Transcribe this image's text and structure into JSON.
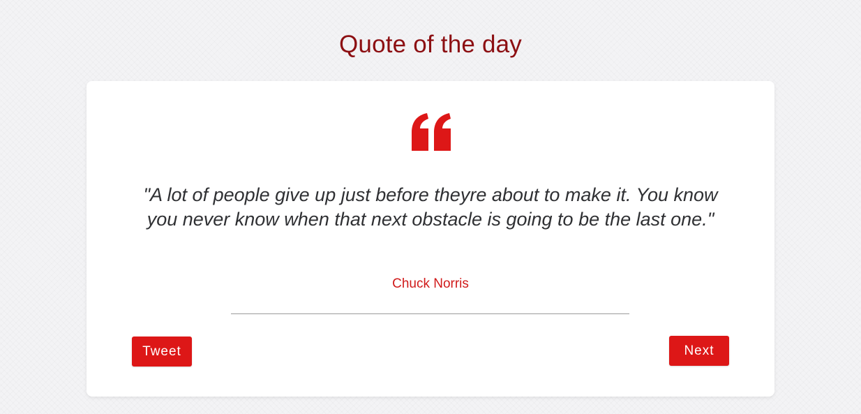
{
  "header": {
    "title": "Quote of the day"
  },
  "card": {
    "quote_icon": "quote-open-icon",
    "quote_text": "\"A lot of people give up just before theyre about to make it. You know you never know when that next obstacle is going to be the last one.\"",
    "author": "Chuck Norris"
  },
  "actions": {
    "tweet_label": "Tweet",
    "next_label": "Next"
  },
  "colors": {
    "title": "#8c0f12",
    "accent": "#dd1717",
    "author": "#d01a1a",
    "quote_text": "#2f3033",
    "background": "#f3f3f5",
    "card": "#ffffff"
  }
}
